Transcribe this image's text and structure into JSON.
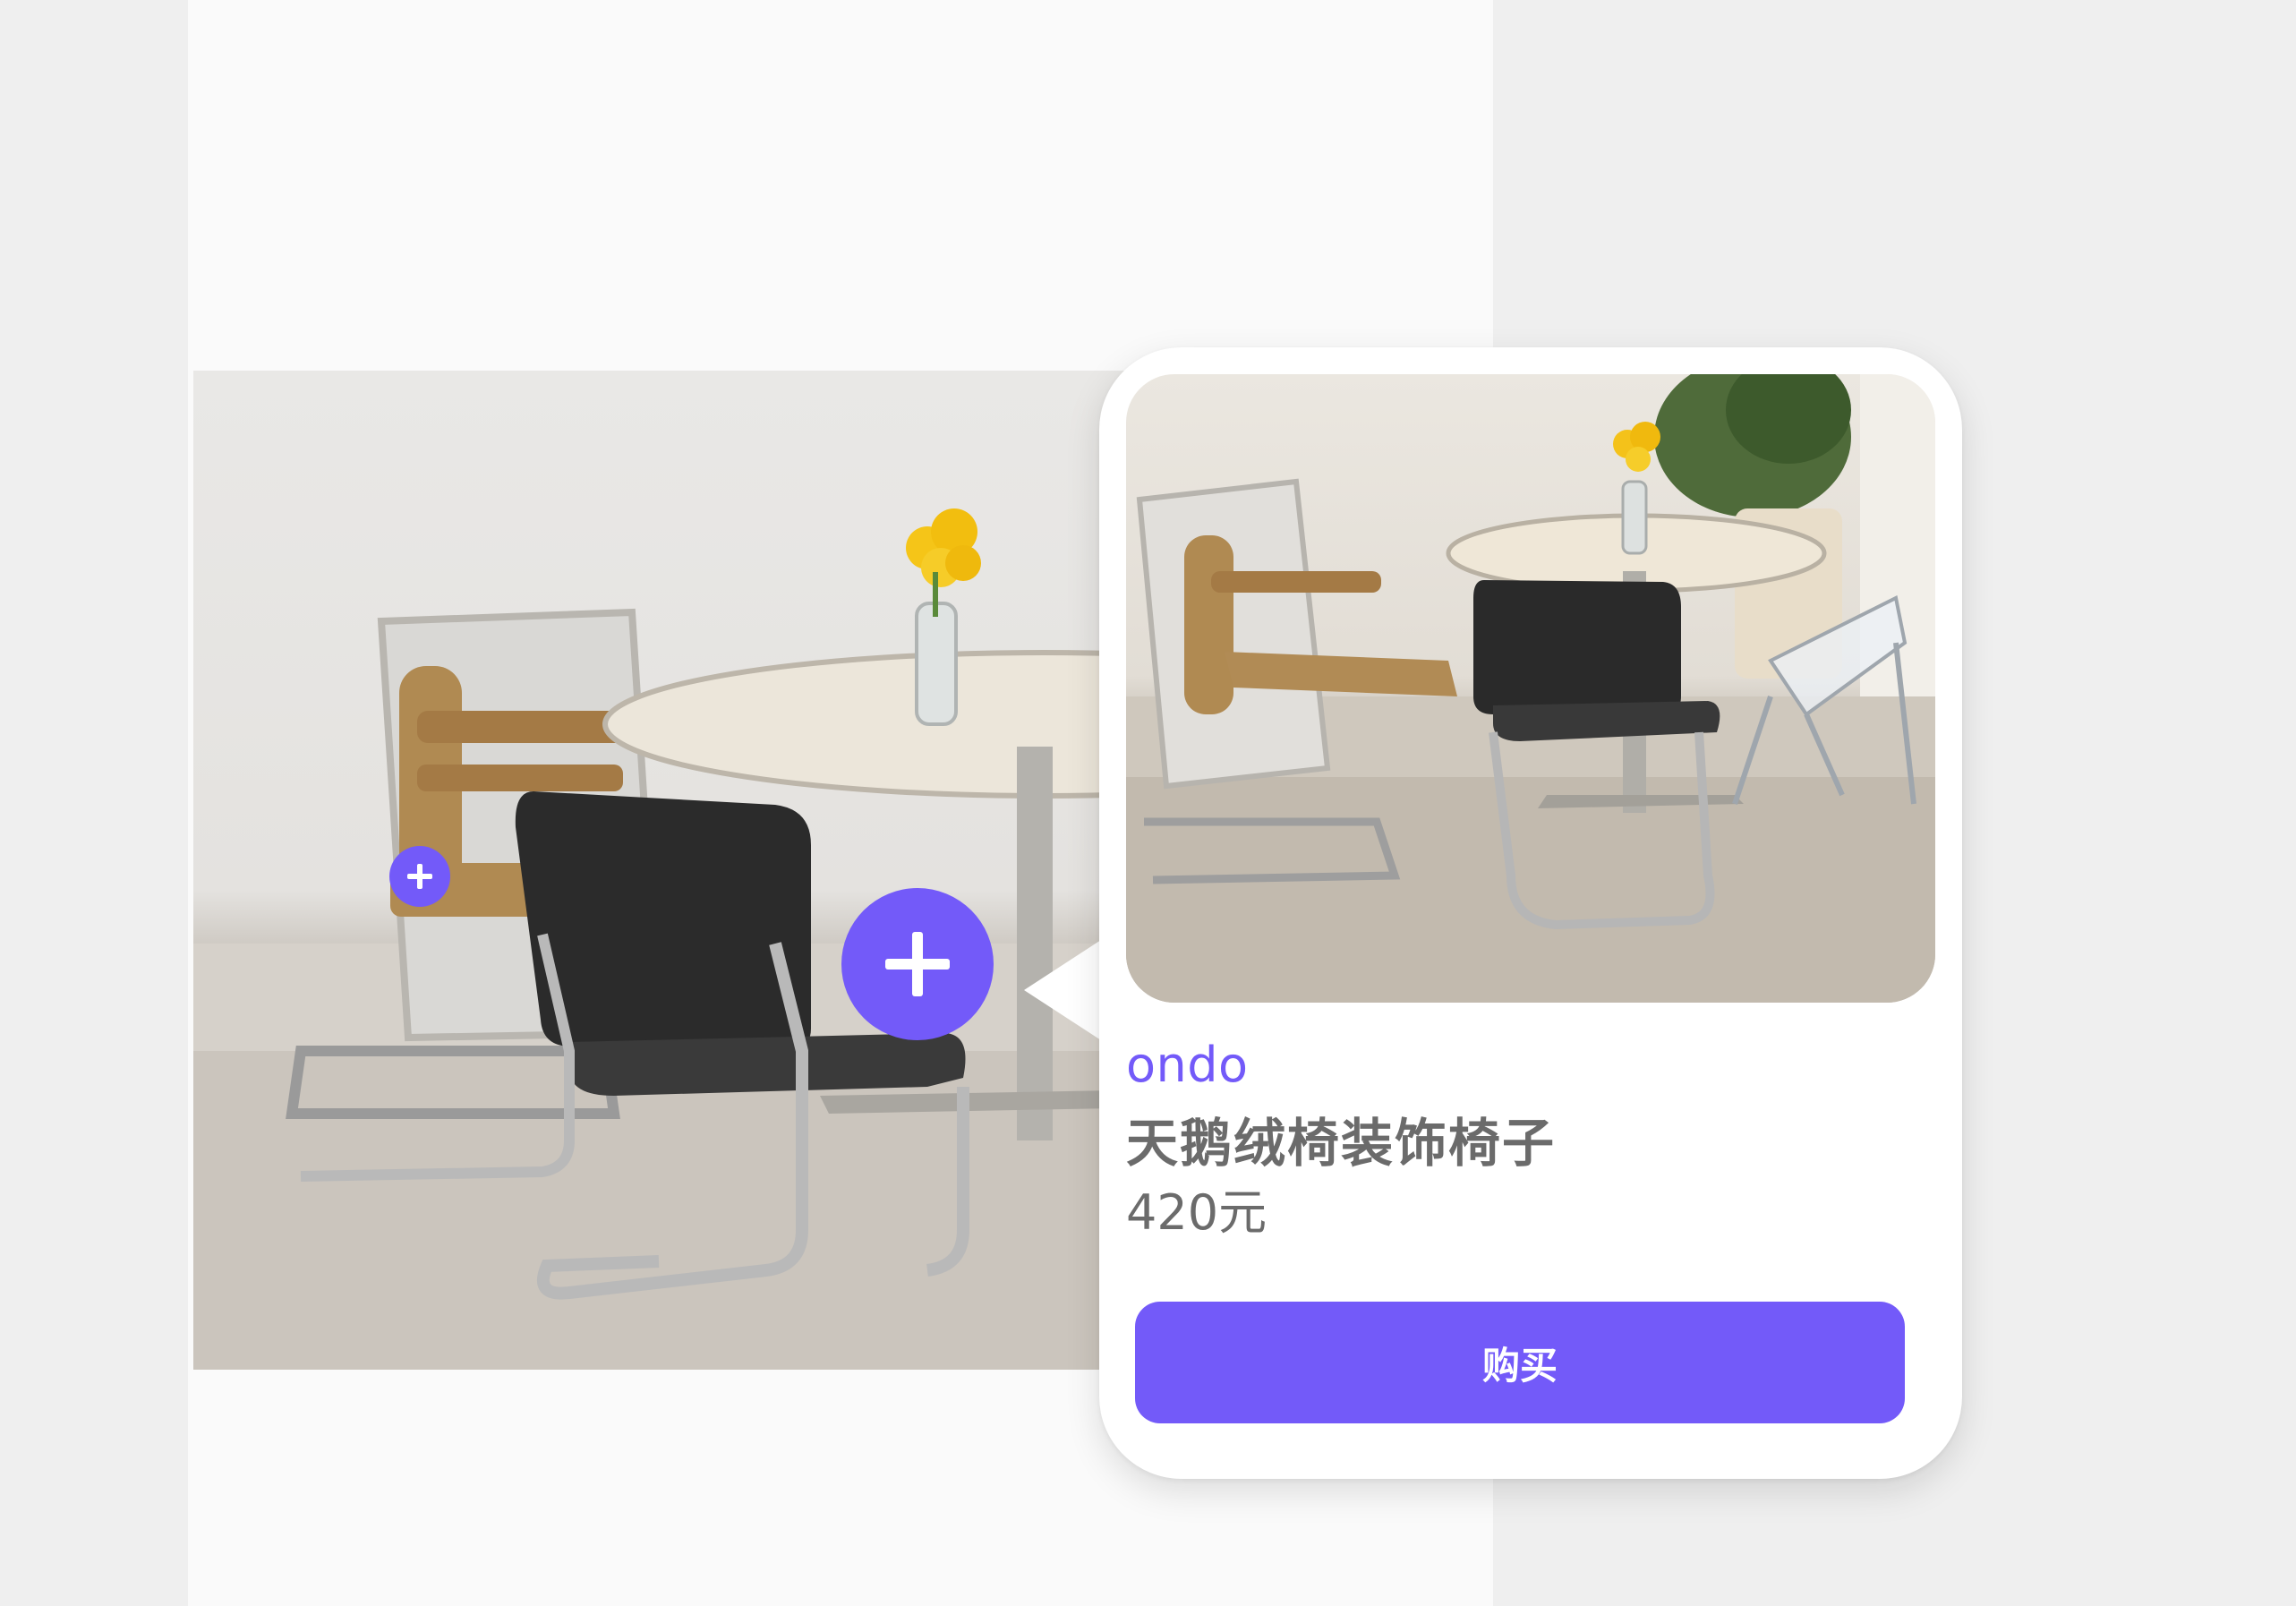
{
  "colors": {
    "accent": "#735af9",
    "background": "#efefef",
    "phone_background": "#fafafa",
    "card_background": "#ffffff",
    "text_muted": "#6b6b6b"
  },
  "main_photo": {
    "description_icon": "room-photo"
  },
  "hotspots": [
    {
      "icon": "plus-icon"
    },
    {
      "icon": "plus-icon"
    }
  ],
  "product_card": {
    "brand": "ondo",
    "title": "天鹅绒椅装饰椅子",
    "price": "420元",
    "buy_label": "购买"
  }
}
